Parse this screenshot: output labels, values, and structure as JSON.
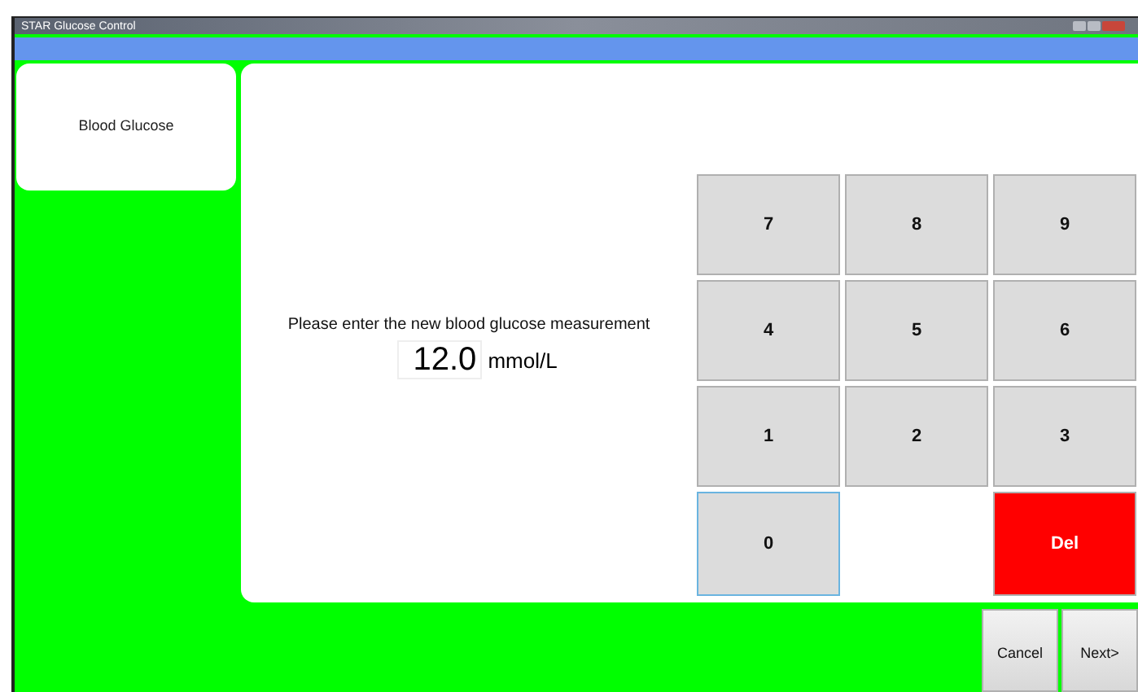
{
  "window": {
    "title": "STAR Glucose Control"
  },
  "tabs": [
    {
      "label": "Blood Glucose",
      "selected": true
    }
  ],
  "prompt": "Please enter the new blood glucose measurement",
  "measurement": {
    "value": "12.0",
    "unit": "mmol/L"
  },
  "keypad": [
    {
      "kind": "digit",
      "label": "7",
      "focused": false
    },
    {
      "kind": "digit",
      "label": "8",
      "focused": false
    },
    {
      "kind": "digit",
      "label": "9",
      "focused": false
    },
    {
      "kind": "digit",
      "label": "4",
      "focused": false
    },
    {
      "kind": "digit",
      "label": "5",
      "focused": false
    },
    {
      "kind": "digit",
      "label": "6",
      "focused": false
    },
    {
      "kind": "digit",
      "label": "1",
      "focused": false
    },
    {
      "kind": "digit",
      "label": "2",
      "focused": false
    },
    {
      "kind": "digit",
      "label": "3",
      "focused": false
    },
    {
      "kind": "digit",
      "label": "0",
      "focused": true
    },
    {
      "kind": "blank"
    },
    {
      "kind": "delete",
      "label": "Del",
      "focused": false
    }
  ],
  "buttons": [
    {
      "label": "Cancel"
    },
    {
      "label": "Next>"
    }
  ]
}
